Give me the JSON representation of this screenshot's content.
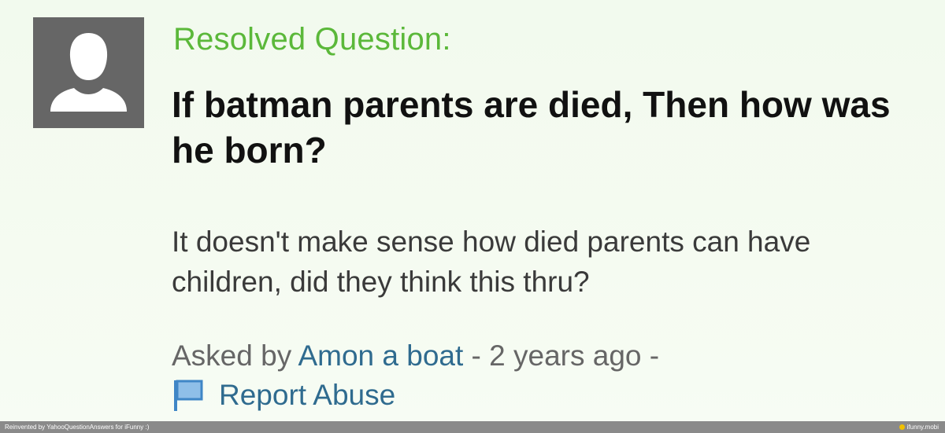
{
  "avatar": {
    "icon": "user-silhouette-icon",
    "background": "#666666"
  },
  "question": {
    "kicker": "Resolved Question:",
    "title": "If batman parents are died, Then how was he born?",
    "details": "It doesn't make sense how died parents can have children, did they think this thru?"
  },
  "meta": {
    "asked_by_prefix": "Asked by",
    "author": "Amon a boat",
    "time": "- 2 years ago -",
    "report_label": "Report Abuse",
    "report_icon": "flag-icon"
  },
  "footer": {
    "credit": "Reinvented by YahooQuestionAnswers for iFunny :)",
    "brand": "ifunny.mobi"
  },
  "colors": {
    "kicker": "#5bb83a",
    "link": "#2f6b8f",
    "footer_bar": "#8a8a8a"
  }
}
